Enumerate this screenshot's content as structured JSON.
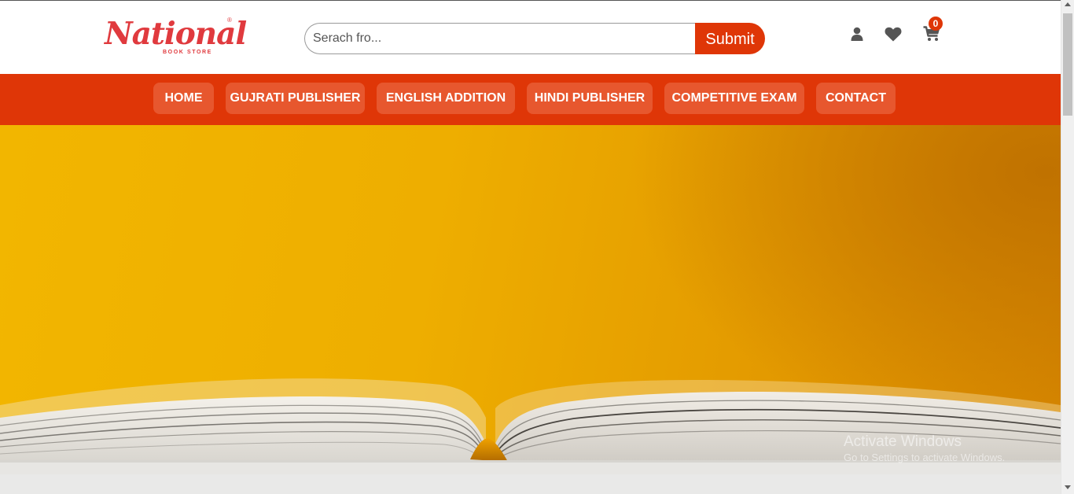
{
  "brand": {
    "logo_word": "National",
    "logo_registered": "®",
    "logo_sub": "BOOK STORE",
    "accent_color": "#df3607",
    "logo_color": "#e03a3e"
  },
  "search": {
    "placeholder": "Serach fro...",
    "value": "",
    "submit_label": "Submit"
  },
  "header_icons": {
    "user": "user-icon",
    "wishlist": "heart-icon",
    "cart": "cart-icon",
    "cart_count": "0"
  },
  "nav": {
    "items": [
      {
        "label": "HOME"
      },
      {
        "label": "GUJRATI PUBLISHER"
      },
      {
        "label": "ENGLISH ADDITION"
      },
      {
        "label": "HINDI PUBLISHER"
      },
      {
        "label": "COMPETITIVE EXAM"
      },
      {
        "label": "CONTACT"
      }
    ]
  },
  "hero": {
    "image": "open-book-on-yellow-background"
  },
  "watermark": {
    "title": "Activate Windows",
    "subtitle": "Go to Settings to activate Windows."
  }
}
